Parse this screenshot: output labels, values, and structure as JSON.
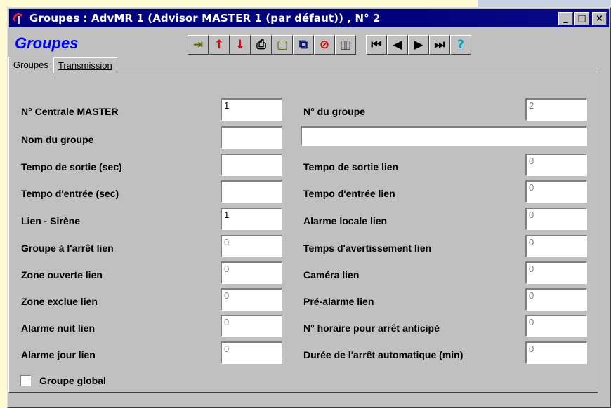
{
  "window": {
    "title": "Groupes : AdvMR 1 (Advisor MASTER 1 (par défaut)) , N° 2",
    "minimize": "_",
    "maximize": "□",
    "close": "×"
  },
  "form_title": "Groupes",
  "toolbar": {
    "buttons": [
      {
        "name": "exit-icon",
        "glyph": "⇥"
      },
      {
        "name": "arrow-up-icon",
        "glyph": "↑"
      },
      {
        "name": "arrow-down-icon",
        "glyph": "↓"
      },
      {
        "name": "print-icon",
        "glyph": "⎙"
      },
      {
        "name": "new-record-icon",
        "glyph": "▢"
      },
      {
        "name": "copy-record-icon",
        "glyph": "⧉"
      },
      {
        "name": "cancel-icon",
        "glyph": "⊘"
      },
      {
        "name": "trash-icon",
        "glyph": "▥"
      },
      {
        "name": "first-record-icon",
        "glyph": "⏮"
      },
      {
        "name": "previous-record-icon",
        "glyph": "◀"
      },
      {
        "name": "next-record-icon",
        "glyph": "▶"
      },
      {
        "name": "last-record-icon",
        "glyph": "⏭"
      },
      {
        "name": "help-icon",
        "glyph": "?"
      }
    ]
  },
  "tabs": [
    {
      "label": "Groupes"
    },
    {
      "label": "Transmission"
    }
  ],
  "left_fields": [
    {
      "label": "N° Centrale MASTER",
      "value": "1",
      "gray": false
    },
    {
      "label": "Nom du groupe",
      "value": "",
      "gray": false
    },
    {
      "label": "Tempo de sortie (sec)",
      "value": "",
      "gray": false
    },
    {
      "label": "Tempo d'entrée (sec)",
      "value": "",
      "gray": false
    },
    {
      "label": "Lien - Sirène",
      "value": "1",
      "gray": false
    },
    {
      "label": "Groupe à l'arrêt lien",
      "value": "0",
      "gray": true
    },
    {
      "label": "Zone ouverte lien",
      "value": "0",
      "gray": true
    },
    {
      "label": "Zone exclue lien",
      "value": "0",
      "gray": true
    },
    {
      "label": "Alarme nuit lien",
      "value": "0",
      "gray": true
    },
    {
      "label": "Alarme jour lien",
      "value": "0",
      "gray": true
    }
  ],
  "right_fields": [
    {
      "label": "N° du groupe",
      "value": "2",
      "gray": true
    },
    {
      "label": "",
      "value": "",
      "gray": false
    },
    {
      "label": "Tempo de sortie lien",
      "value": "0",
      "gray": true
    },
    {
      "label": "Tempo d'entrée lien",
      "value": "0",
      "gray": true
    },
    {
      "label": "Alarme locale lien",
      "value": "0",
      "gray": true
    },
    {
      "label": "Temps d'avertissement lien",
      "value": "0",
      "gray": true
    },
    {
      "label": "Caméra lien",
      "value": "0",
      "gray": true
    },
    {
      "label": "Pré-alarme lien",
      "value": "0",
      "gray": true
    },
    {
      "label": "N° horaire pour arrêt anticipé",
      "value": "0",
      "gray": true
    },
    {
      "label": "Durée de l'arrêt automatique (min)",
      "value": "0",
      "gray": true
    }
  ],
  "checkbox": {
    "label": "Groupe global",
    "checked": false
  }
}
